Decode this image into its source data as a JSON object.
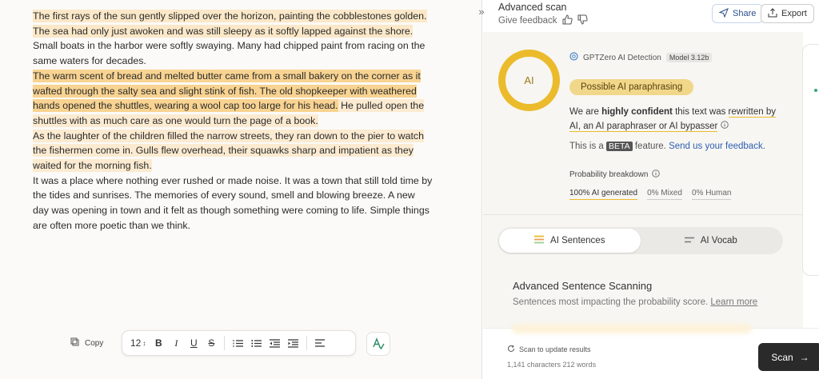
{
  "document": {
    "segments": [
      {
        "text": "The first rays of the sun gently slipped over the horizon, painting the cobblestones golden. The sea had only just awoken and was still sleepy as it softly lapped against the shore.",
        "level": "h1"
      },
      {
        "text": " Small boats in the harbor were softly swaying. Many had chipped paint from racing on the same waters for decades.",
        "level": "h0"
      },
      {
        "text": "The warm scent of bread and melted butter came from a small bakery on the corner as it wafted through the salty sea and slight stink of fish.",
        "level": "h2"
      },
      {
        "text": " The old shopkeeper with weathered hands opened the shuttles, wearing a wool cap too large for his head.",
        "level": "h2"
      },
      {
        "text": " He pulled open the shuttles with as much care as one would turn the page of a book.",
        "level": "h3"
      },
      {
        "text": "As the laughter of the children filled the narrow streets, they ran down to the pier to watch the fishermen come in. Gulls flew overhead, their squawks sharp and impatient as they waited for the morning fish.",
        "level": "h3"
      },
      {
        "text": "It was a place where nothing ever rushed or made noise. It was a town that still told time by the tides and sunrises. The memories of every sound, smell and blowing breeze. A new day was opening in town and it felt as though something were coming to life. Simple things are often more poetic than we think.",
        "level": "h0"
      }
    ]
  },
  "editor": {
    "copy_label": "Copy",
    "font_size": "12",
    "bold": "B",
    "italic": "I",
    "underline": "U",
    "strike": "S"
  },
  "header": {
    "title": "Advanced scan",
    "feedback": "Give feedback",
    "share": "Share",
    "export": "Export"
  },
  "result": {
    "ring_label": "AI",
    "detector": "GPTZero AI Detection",
    "model": "Model 3.12b",
    "badge": "Possible AI paraphrasing",
    "conf_pre": "We are ",
    "conf_strong": "highly confident",
    "conf_mid": " this text was ",
    "conf_link": "rewritten by AI, an AI paraphraser or AI bypasser",
    "beta_pre": "This is a ",
    "beta_tag": "BETA",
    "beta_mid": " feature. ",
    "beta_link": "Send us your feedback.",
    "prob_title": "Probability breakdown",
    "prob_ai": "100% AI generated",
    "prob_mixed": "0% Mixed",
    "prob_human": "0% Human"
  },
  "tabs": {
    "sentences": "AI Sentences",
    "vocab": "AI Vocab"
  },
  "advanced": {
    "title": "Advanced Sentence Scanning",
    "subtitle": "Sentences most impacting the probability score.",
    "learn_more": "Learn more"
  },
  "footer": {
    "scan_update": "Scan to update results",
    "counts": "1,141 characters 212 words",
    "scan": "Scan"
  },
  "colors": {
    "accent": "#ebbb2c",
    "highlight_strong": "#f8d391",
    "highlight_light": "#fbe8c8"
  }
}
